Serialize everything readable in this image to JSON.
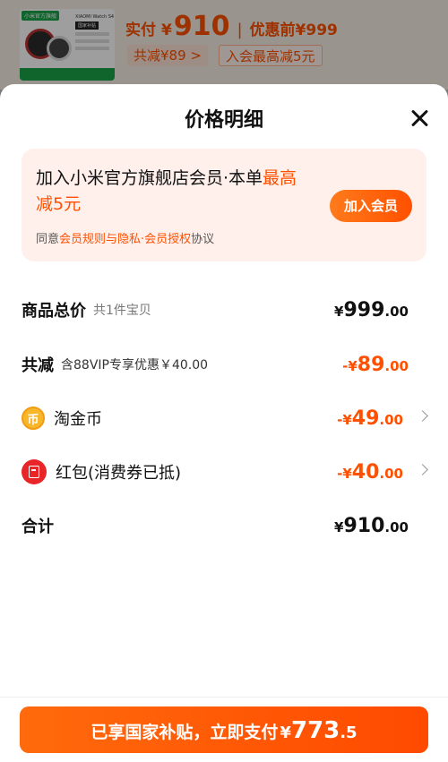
{
  "background": {
    "thumb_tag": "小米官方旗舰",
    "thumb_title": "XIAOMI Watch S4",
    "thumb_badge": "国家补贴",
    "pay_label": "实付",
    "yen": "¥",
    "pay_price": "910",
    "separator": "|",
    "orig_label": "优惠前¥999",
    "chip_discount": "共减¥89 >",
    "chip_member": "入会最高减5元"
  },
  "sheet": {
    "title": "价格明细"
  },
  "member": {
    "text_before": "加入小米官方旗舰店会员·本单",
    "text_highlight": "最高减5元",
    "button": "加入会员",
    "agree_prefix": "同意",
    "agree_link": "会员规则与隐私·会员授权",
    "agree_suffix": "协议"
  },
  "rows": {
    "total": {
      "label": "商品总价",
      "sub": "共1件宝贝",
      "yen": "¥",
      "int": "999",
      "dec": ".00"
    },
    "discount": {
      "label": "共减",
      "sub": "含88VIP专享优惠￥40.00",
      "yen": "-¥",
      "int": "89",
      "dec": ".00"
    },
    "coin": {
      "label": "淘金币",
      "icon": "币",
      "yen": "-¥",
      "int": "49",
      "dec": ".00"
    },
    "hongbao": {
      "label": "红包(消费券已抵)",
      "yen": "-¥",
      "int": "40",
      "dec": ".00"
    },
    "sum": {
      "label": "合计",
      "yen": "¥",
      "int": "910",
      "dec": ".00"
    }
  },
  "pay_button": {
    "text": "已享国家补贴，立即支付",
    "yen": "¥",
    "int": "773",
    "dec": ".5"
  },
  "colors": {
    "accent": "#ff5000",
    "member_bg": "#fff0eb"
  }
}
